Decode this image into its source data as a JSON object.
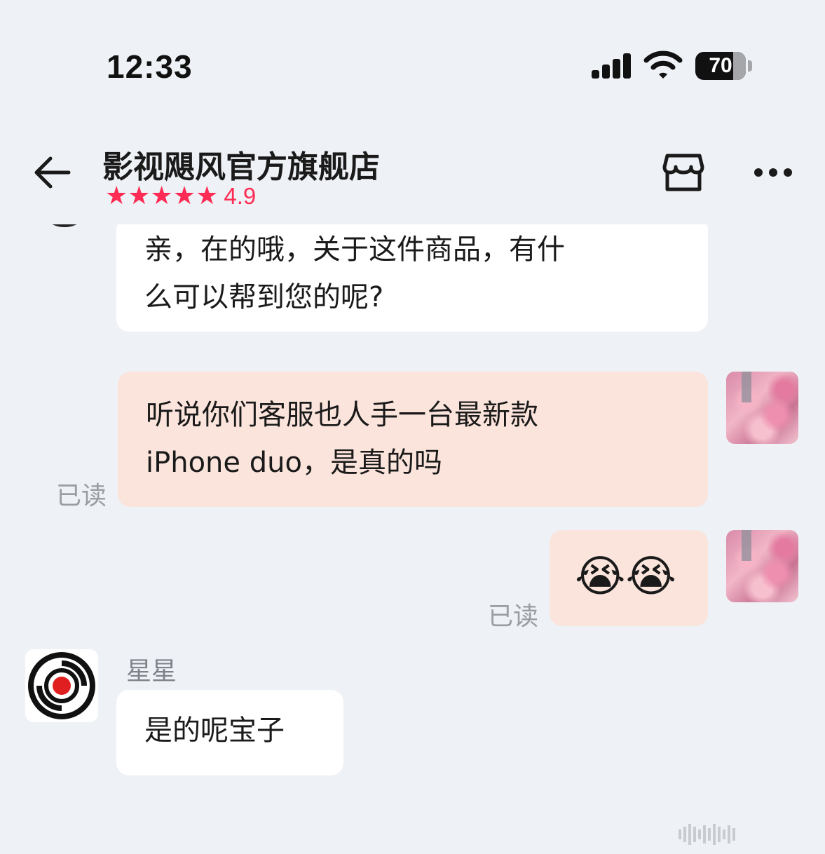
{
  "status_bar": {
    "time": "12:33",
    "battery_level": "70"
  },
  "header": {
    "store_name": "影视飓风官方旗舰店",
    "rating_stars": "★★★★★",
    "rating_value": "4.9",
    "accent_color": "#fe2c55"
  },
  "icons": [
    "back-arrow-icon",
    "store-icon",
    "more-dots-icon",
    "signal-icon",
    "wifi-icon",
    "battery-icon"
  ],
  "messages": [
    {
      "side": "in",
      "lines": [
        "亲，在的哦，关于这件商品，有什",
        "么可以帮到您的呢?"
      ]
    },
    {
      "side": "out",
      "lines": [
        "听说你们客服也人手一台最新款",
        "iPhone duo，是真的吗"
      ],
      "status": "已读"
    },
    {
      "side": "out",
      "emoji": "😭😭",
      "status": "已读"
    },
    {
      "side": "in",
      "sender": "星星",
      "text": "是的呢宝子"
    }
  ],
  "colors": {
    "background": "#eef1f5",
    "incoming_bubble": "#ffffff",
    "outgoing_bubble": "#fbe4dc",
    "read_status": "#9a9ca3"
  }
}
